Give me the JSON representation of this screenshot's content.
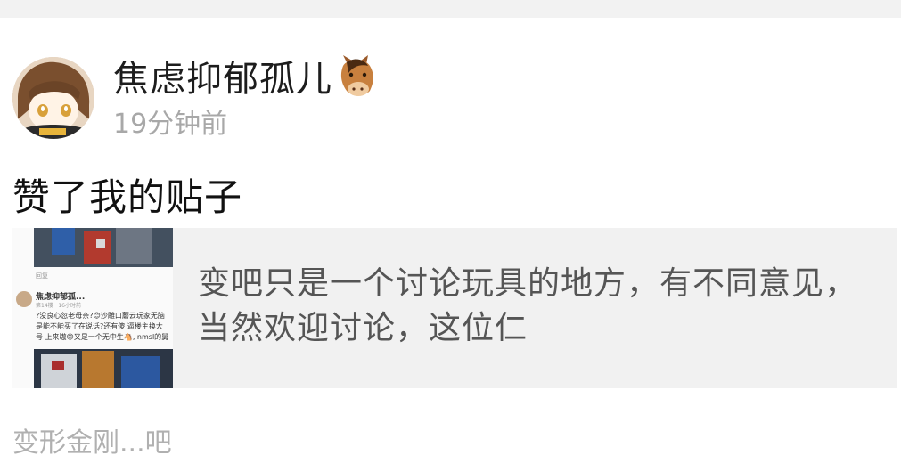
{
  "notification": {
    "user": {
      "name": "焦虑抑郁孤儿",
      "badge_icon": "horse-face-emoji",
      "avatar_icon": "anime-avatar"
    },
    "time_ago": "19分钟前",
    "action": "赞了我的贴子"
  },
  "post": {
    "excerpt": "变吧只是一个讨论玩具的地方，有不同意见，当然欢迎讨论，这位仁",
    "thumbnail": {
      "reply_label": "回复",
      "author": "焦虑抑郁孤...",
      "meta": "第14楼 · 16小时前",
      "text": "?没良心忽老母亲?😊沙雕口蘑云玩家无脑 是能不能买了在说话?还有傻 逼楼主换大号 上来嗷😊又是一个无中生🐴, nmsl的舅"
    }
  },
  "forum": {
    "name": "变形金刚...吧"
  },
  "colors": {
    "background": "#ffffff",
    "card_background": "#f1f1f1",
    "muted_text": "#a8a8a8",
    "primary_text": "#111111"
  }
}
